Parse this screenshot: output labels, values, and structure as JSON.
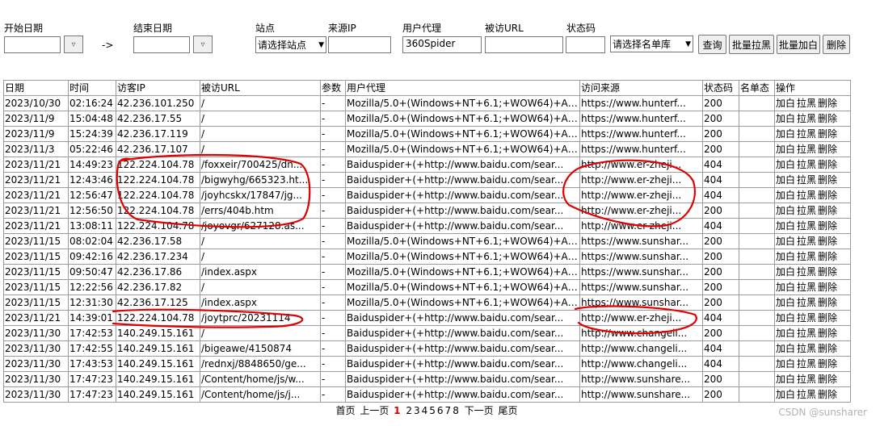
{
  "filters": {
    "start_date_label": "开始日期",
    "end_date_label": "结束日期",
    "site_label": "站点",
    "source_ip_label": "来源IP",
    "user_agent_label": "用户代理",
    "visited_url_label": "被访URL",
    "status_label": "状态码",
    "arrow_text": "->",
    "picker_glyph": "▿",
    "site_select_value": "请选择站点",
    "user_agent_value": "360Spider",
    "list_select_value": "请选择名单库",
    "query_button": "查询",
    "batch_block_button": "批量拉黑",
    "batch_white_button": "批量加白",
    "delete_button": "删除"
  },
  "table": {
    "headers": [
      "日期",
      "时间",
      "访客IP",
      "被访URL",
      "参数",
      "用户代理",
      "访问来源",
      "状态码",
      "名单态",
      "操作"
    ],
    "actions": [
      "加白",
      "拉黑",
      "删除"
    ],
    "rows": [
      {
        "date": "2023/10/30",
        "time": "02:16:24",
        "ip": "42.236.101.250",
        "url": "/",
        "param": "-",
        "ua": "Mozilla/5.0+(Windows+NT+6.1;+WOW64)+App...",
        "ref": "https://www.hunterf...",
        "status": "200",
        "list": ""
      },
      {
        "date": "2023/11/9",
        "time": "15:04:48",
        "ip": "42.236.17.55",
        "url": "/",
        "param": "-",
        "ua": "Mozilla/5.0+(Windows+NT+6.1;+WOW64)+App...",
        "ref": "https://www.hunterf...",
        "status": "200",
        "list": ""
      },
      {
        "date": "2023/11/9",
        "time": "15:24:39",
        "ip": "42.236.17.119",
        "url": "/",
        "param": "-",
        "ua": "Mozilla/5.0+(Windows+NT+6.1;+WOW64)+App...",
        "ref": "https://www.hunterf...",
        "status": "200",
        "list": ""
      },
      {
        "date": "2023/11/3",
        "time": "05:22:46",
        "ip": "42.236.17.107",
        "url": "/",
        "param": "-",
        "ua": "Mozilla/5.0+(Windows+NT+6.1;+WOW64)+App...",
        "ref": "https://www.hunterf...",
        "status": "200",
        "list": ""
      },
      {
        "date": "2023/11/21",
        "time": "14:49:23",
        "ip": "122.224.104.78",
        "url": "/foxxeir/700425/dn...",
        "param": "-",
        "ua": "Baiduspider+(+http://www.baidu.com/sear...",
        "ref": "http://www.er-zheji...",
        "status": "404",
        "list": ""
      },
      {
        "date": "2023/11/21",
        "time": "12:43:46",
        "ip": "122.224.104.78",
        "url": "/bigwyhg/665323.ht...",
        "param": "-",
        "ua": "Baiduspider+(+http://www.baidu.com/sear...",
        "ref": "http://www.er-zheji...",
        "status": "404",
        "list": ""
      },
      {
        "date": "2023/11/21",
        "time": "12:56:47",
        "ip": "122.224.104.78",
        "url": "/joyhcskx/17847/jg...",
        "param": "-",
        "ua": "Baiduspider+(+http://www.baidu.com/sear...",
        "ref": "http://www.er-zheji...",
        "status": "404",
        "list": ""
      },
      {
        "date": "2023/11/21",
        "time": "12:56:50",
        "ip": "122.224.104.78",
        "url": "/errs/404b.htm",
        "param": "-",
        "ua": "Baiduspider+(+http://www.baidu.com/sear...",
        "ref": "http://www.er-zheji...",
        "status": "200",
        "list": ""
      },
      {
        "date": "2023/11/21",
        "time": "13:08:11",
        "ip": "122.224.104.78",
        "url": "/joyovgr/627128.as...",
        "param": "-",
        "ua": "Baiduspider+(+http://www.baidu.com/sear...",
        "ref": "http://www.er-zheji...",
        "status": "404",
        "list": ""
      },
      {
        "date": "2023/11/15",
        "time": "08:02:04",
        "ip": "42.236.17.58",
        "url": "/",
        "param": "-",
        "ua": "Mozilla/5.0+(Windows+NT+6.1;+WOW64)+App...",
        "ref": "https://www.sunshar...",
        "status": "200",
        "list": ""
      },
      {
        "date": "2023/11/15",
        "time": "09:42:16",
        "ip": "42.236.17.234",
        "url": "/",
        "param": "-",
        "ua": "Mozilla/5.0+(Windows+NT+6.1;+WOW64)+App...",
        "ref": "https://www.sunshar...",
        "status": "200",
        "list": ""
      },
      {
        "date": "2023/11/15",
        "time": "09:50:47",
        "ip": "42.236.17.86",
        "url": "/index.aspx",
        "param": "-",
        "ua": "Mozilla/5.0+(Windows+NT+6.1;+WOW64)+App...",
        "ref": "https://www.sunshar...",
        "status": "200",
        "list": ""
      },
      {
        "date": "2023/11/15",
        "time": "12:22:56",
        "ip": "42.236.17.82",
        "url": "/",
        "param": "-",
        "ua": "Mozilla/5.0+(Windows+NT+6.1;+WOW64)+App...",
        "ref": "https://www.sunshar...",
        "status": "200",
        "list": ""
      },
      {
        "date": "2023/11/15",
        "time": "12:31:30",
        "ip": "42.236.17.125",
        "url": "/index.aspx",
        "param": "-",
        "ua": "Mozilla/5.0+(Windows+NT+6.1;+WOW64)+App...",
        "ref": "https://www.sunshar...",
        "status": "200",
        "list": ""
      },
      {
        "date": "2023/11/21",
        "time": "14:39:01",
        "ip": "122.224.104.78",
        "url": "/joytprc/20231114",
        "param": "-",
        "ua": "Baiduspider+(+http://www.baidu.com/sear...",
        "ref": "http://www.er-zheji...",
        "status": "404",
        "list": ""
      },
      {
        "date": "2023/11/30",
        "time": "17:42:53",
        "ip": "140.249.15.161",
        "url": "/",
        "param": "-",
        "ua": "Baiduspider+(+http://www.baidu.com/sear...",
        "ref": "http://www.changeli...",
        "status": "200",
        "list": ""
      },
      {
        "date": "2023/11/30",
        "time": "17:42:55",
        "ip": "140.249.15.161",
        "url": "/bigeawe/4150874",
        "param": "-",
        "ua": "Baiduspider+(+http://www.baidu.com/sear...",
        "ref": "http://www.changeli...",
        "status": "404",
        "list": ""
      },
      {
        "date": "2023/11/30",
        "time": "17:43:53",
        "ip": "140.249.15.161",
        "url": "/rednxj/8848650/ge...",
        "param": "-",
        "ua": "Baiduspider+(+http://www.baidu.com/sear...",
        "ref": "http://www.changeli...",
        "status": "404",
        "list": ""
      },
      {
        "date": "2023/11/30",
        "time": "17:47:23",
        "ip": "140.249.15.161",
        "url": "/Content/home/js/w...",
        "param": "-",
        "ua": "Baiduspider+(+http://www.baidu.com/sear...",
        "ref": "http://www.sunshare...",
        "status": "200",
        "list": ""
      },
      {
        "date": "2023/11/30",
        "time": "17:47:23",
        "ip": "140.249.15.161",
        "url": "/Content/home/js/j...",
        "param": "-",
        "ua": "Baiduspider+(+http://www.baidu.com/sear...",
        "ref": "http://www.sunshare...",
        "status": "200",
        "list": ""
      }
    ]
  },
  "pager": {
    "first": "首页",
    "prev": "上一页",
    "current": "1",
    "pages": [
      "2",
      "3",
      "4",
      "5",
      "6",
      "7",
      "8"
    ],
    "next": "下一页",
    "last": "尾页"
  },
  "watermark": "CSDN @sunsharer",
  "colors": {
    "annotation": "#e00000",
    "current_page": "#d40000"
  }
}
